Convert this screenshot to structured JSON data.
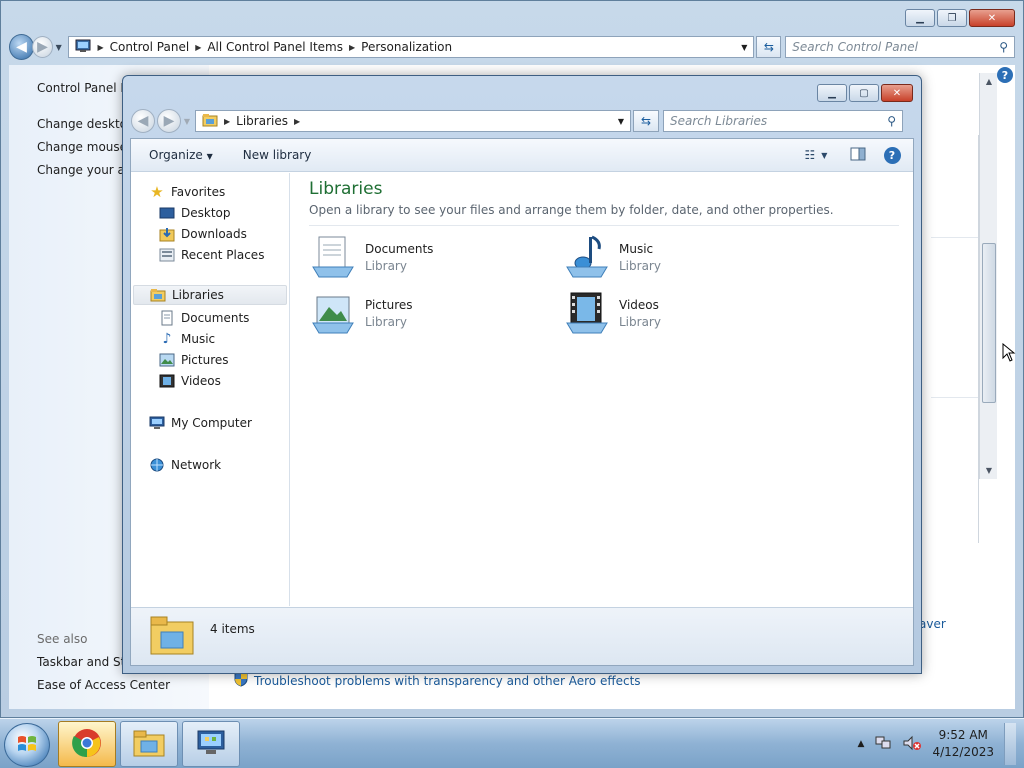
{
  "control_panel": {
    "breadcrumb": [
      "Control Panel",
      "All Control Panel Items",
      "Personalization"
    ],
    "search_placeholder": "Search Control Panel",
    "left_links": [
      "Control Panel H",
      "Change desktop",
      "Change mouse p",
      "Change your ac"
    ],
    "see_also_label": "See also",
    "see_also_links": [
      "Taskbar and Star",
      "Ease of Access Center"
    ],
    "troubleshoot_link": "Troubleshoot problems with transparency and other Aero effects",
    "saver_link": "aver"
  },
  "libraries_window": {
    "breadcrumb": [
      "Libraries"
    ],
    "search_placeholder": "Search Libraries",
    "toolbar": {
      "organize_label": "Organize",
      "new_library_label": "New library"
    },
    "nav": {
      "favorites": "Favorites",
      "favorites_items": [
        "Desktop",
        "Downloads",
        "Recent Places"
      ],
      "libraries": "Libraries",
      "libraries_items": [
        "Documents",
        "Music",
        "Pictures",
        "Videos"
      ],
      "computer": "My Computer",
      "network": "Network"
    },
    "heading": "Libraries",
    "subheading": "Open a library to see your files and arrange them by folder, date, and other properties.",
    "items": [
      {
        "name": "Documents",
        "type": "Library",
        "icon": "documents-library-icon"
      },
      {
        "name": "Music",
        "type": "Library",
        "icon": "music-library-icon"
      },
      {
        "name": "Pictures",
        "type": "Library",
        "icon": "pictures-library-icon"
      },
      {
        "name": "Videos",
        "type": "Library",
        "icon": "videos-library-icon"
      }
    ],
    "status_count": "4 items"
  },
  "taskbar": {
    "clock_time": "9:52 AM",
    "clock_date": "4/12/2023",
    "pinned": [
      "chrome-icon",
      "libraries-folder-icon",
      "control-panel-icon"
    ]
  },
  "colors": {
    "heading_green": "#1f6f34",
    "link_blue": "#1a5a9a"
  }
}
